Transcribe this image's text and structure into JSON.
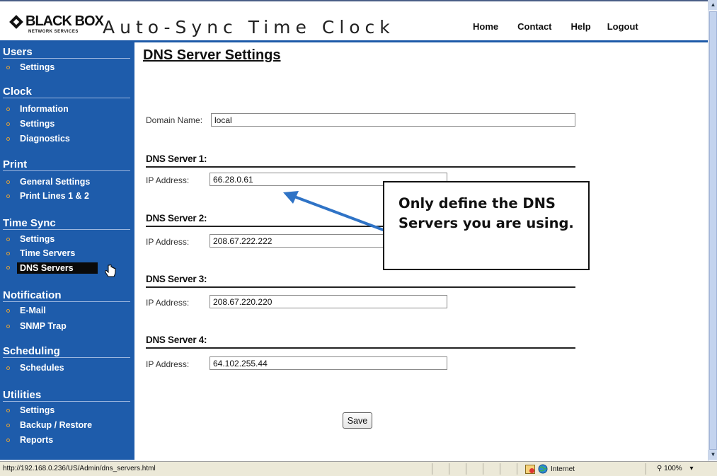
{
  "header": {
    "logo_text": "BLACK BOX",
    "logo_subtext": "NETWORK SERVICES",
    "app_title": "Auto-Sync Time Clock",
    "nav": [
      "Home",
      "Contact",
      "Help",
      "Logout"
    ]
  },
  "sidebar": {
    "sections": [
      {
        "title": "Users",
        "items": [
          "Settings"
        ]
      },
      {
        "title": "Clock",
        "items": [
          "Information",
          "Settings",
          "Diagnostics"
        ]
      },
      {
        "title": "Print",
        "items": [
          "General Settings",
          "Print Lines 1 & 2"
        ]
      },
      {
        "title": "Time Sync",
        "items": [
          "Settings",
          "Time Servers",
          "DNS Servers"
        ]
      },
      {
        "title": "Notification",
        "items": [
          "E-Mail",
          "SNMP Trap"
        ]
      },
      {
        "title": "Scheduling",
        "items": [
          "Schedules"
        ]
      },
      {
        "title": "Utilities",
        "items": [
          "Settings",
          "Backup / Restore",
          "Reports"
        ]
      }
    ],
    "active_item": "DNS Servers"
  },
  "main": {
    "title": "DNS Server Settings",
    "domain_label": "Domain Name:",
    "domain_value": "local",
    "ip_label": "IP Address:",
    "servers": [
      {
        "heading": "DNS Server 1:",
        "ip": "66.28.0.61"
      },
      {
        "heading": "DNS Server 2:",
        "ip": "208.67.222.222"
      },
      {
        "heading": "DNS Server 3:",
        "ip": "208.67.220.220"
      },
      {
        "heading": "DNS Server 4:",
        "ip": "64.102.255.44"
      }
    ],
    "save_label": "Save"
  },
  "callout": {
    "text": "Only define the DNS Servers you are using."
  },
  "statusbar": {
    "url": "http://192.168.0.236/US/Admin/dns_servers.html",
    "zone": "Internet",
    "zoom": "100%"
  },
  "colors": {
    "sidebar_bg": "#1e5cab",
    "header_rule": "#1d5aa8",
    "bullet": "#e0a23a",
    "arrow": "#2f73c6"
  }
}
